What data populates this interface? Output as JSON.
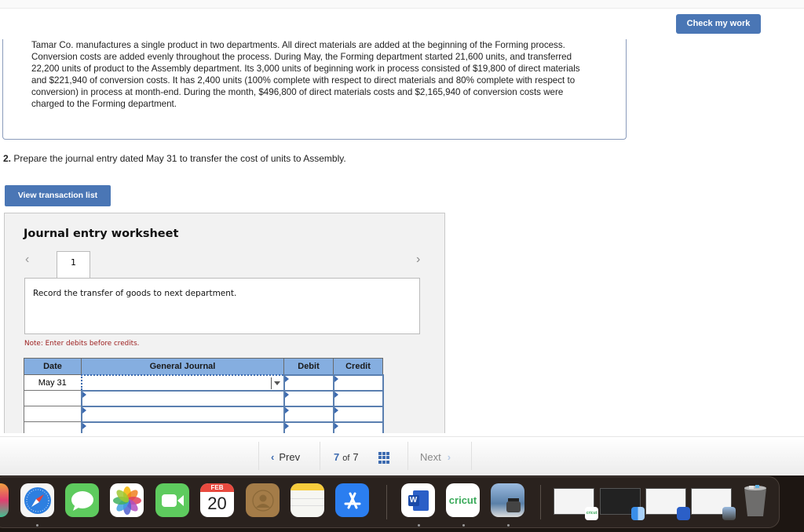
{
  "header": {
    "check_button": "Check my work"
  },
  "problem": {
    "text": "Tamar Co. manufactures a single product in two departments. All direct materials are added at the beginning of the Forming process. Conversion costs are added evenly throughout the process. During May, the Forming department started 21,600 units, and transferred 22,200 units of product to the Assembly department. Its 3,000 units of beginning work in process consisted of $19,800 of direct materials and $221,940 of conversion costs. It has 2,400 units (100% complete with respect to direct materials and 80% complete with respect to conversion) in process at month-end. During the month, $496,800 of direct materials costs and $2,165,940 of conversion costs were charged to the Forming department."
  },
  "question": {
    "number": "2.",
    "text": " Prepare the journal entry dated May 31 to transfer the cost of units to Assembly."
  },
  "view_button": "View transaction list",
  "worksheet": {
    "title": "Journal entry worksheet",
    "tab_label": "1",
    "description": "Record the transfer of goods to next department.",
    "note": "Note: Enter debits before credits.",
    "columns": [
      "Date",
      "General Journal",
      "Debit",
      "Credit"
    ],
    "rows": [
      {
        "date": "May 31",
        "account": "",
        "debit": "",
        "credit": ""
      },
      {
        "date": "",
        "account": "",
        "debit": "",
        "credit": ""
      },
      {
        "date": "",
        "account": "",
        "debit": "",
        "credit": ""
      },
      {
        "date": "",
        "account": "",
        "debit": "",
        "credit": ""
      }
    ]
  },
  "pagination": {
    "prev": "Prev",
    "current": "7",
    "of": "of",
    "total": "7",
    "next": "Next"
  },
  "dock": {
    "calendar_month": "FEB",
    "calendar_day": "20",
    "cricut_label": "cricut",
    "word_label": "W",
    "apps": [
      "launchpad",
      "safari",
      "messages",
      "photos",
      "facetime",
      "calendar",
      "contacts",
      "notes",
      "app-store",
      "word",
      "cricut",
      "preview"
    ]
  },
  "colors": {
    "accent": "#4a76b5",
    "table_header": "#85aee0",
    "note_red": "#9b1c1c"
  }
}
